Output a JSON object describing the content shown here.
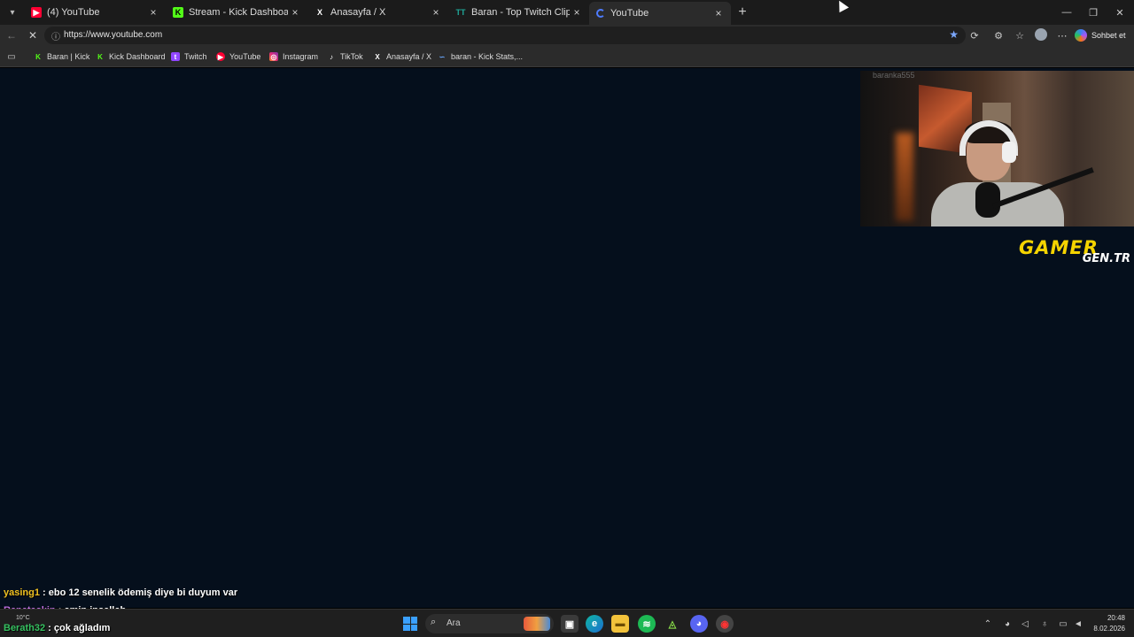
{
  "tabs": [
    {
      "label": "(4) YouTube",
      "icon": "youtube-icon",
      "color": "#ff0033"
    },
    {
      "label": "Stream - Kick Dashboard",
      "icon": "kick-icon",
      "color": "#53fc18"
    },
    {
      "label": "Anasayfa / X",
      "icon": "x-icon",
      "color": "#ffffff"
    },
    {
      "label": "Baran - Top Twitch Clips - TwitchTr",
      "icon": "twitchtracker-icon",
      "color": "#1fa89a"
    },
    {
      "label": "YouTube",
      "icon": "loading-spinner-icon",
      "color": "#4e7cff"
    }
  ],
  "address_bar": {
    "url": "https://www.youtube.com",
    "copilot_label": "Sohbet et"
  },
  "bookmarks": [
    {
      "label": "Baran | Kick",
      "icon": "kick-icon"
    },
    {
      "label": "Kick Dashboard",
      "icon": "kick-icon"
    },
    {
      "label": "Twitch",
      "icon": "twitch-icon"
    },
    {
      "label": "YouTube",
      "icon": "youtube-icon"
    },
    {
      "label": "Instagram",
      "icon": "instagram-icon"
    },
    {
      "label": "TikTok",
      "icon": "tiktok-icon"
    },
    {
      "label": "Anasayfa / X",
      "icon": "x-icon"
    },
    {
      "label": "baran - Kick Stats,...",
      "icon": "kickstats-icon"
    }
  ],
  "overlay": {
    "brand_line1": "GAMER",
    "brand_line2": "GEN.TR",
    "webcam_watermark": "baranka555"
  },
  "chat": [
    {
      "user": "yasing1",
      "message": " : ebo 12 senelik ödemiş diye bi duyum var",
      "color": "#f0c020"
    },
    {
      "user": "Ranataskin",
      "message": " : amin inşallah",
      "color": "#c070e0"
    },
    {
      "user": "Berath32",
      "message": " : çok ağladım",
      "color": "#36c060"
    }
  ],
  "taskbar": {
    "search_placeholder": "Ara",
    "weather": "10°C",
    "time": "20:48",
    "date": "8.02.2026"
  },
  "colors": {
    "content_bg": "#050f1c",
    "chrome_bg": "#2b2b2b",
    "brand_yellow": "#f5d400"
  }
}
